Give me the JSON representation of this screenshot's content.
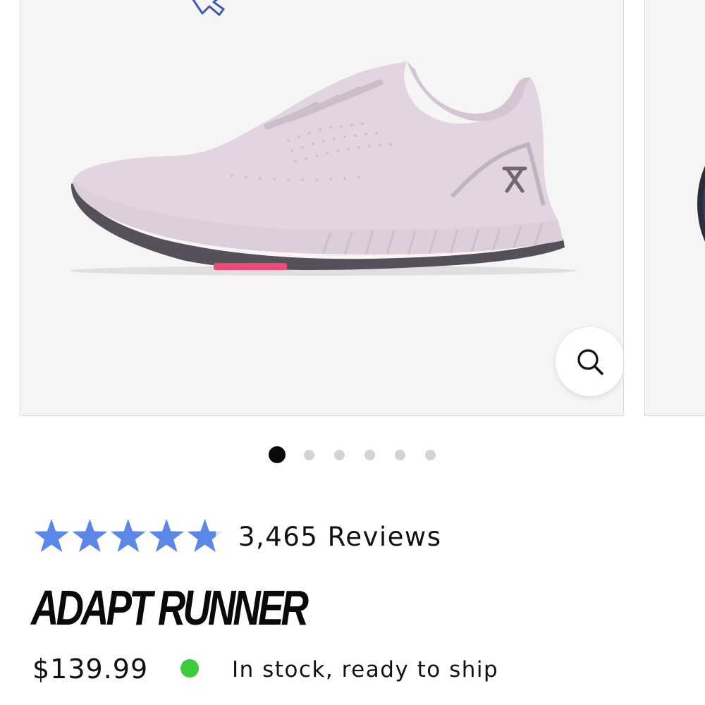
{
  "gallery": {
    "main_image": "adapt-runner-lilac-side-view",
    "zoom_icon": "search-icon",
    "slide_count": 6,
    "active_slide": 1
  },
  "rating": {
    "stars": 4.8,
    "max_stars": 5,
    "star_color": "#5b87e8",
    "reviews_label": "3,465 Reviews"
  },
  "product": {
    "title": "ADAPT RUNNER",
    "price": "$139.99",
    "stock_status": "In stock, ready to ship",
    "stock_color": "#3fca3a"
  }
}
